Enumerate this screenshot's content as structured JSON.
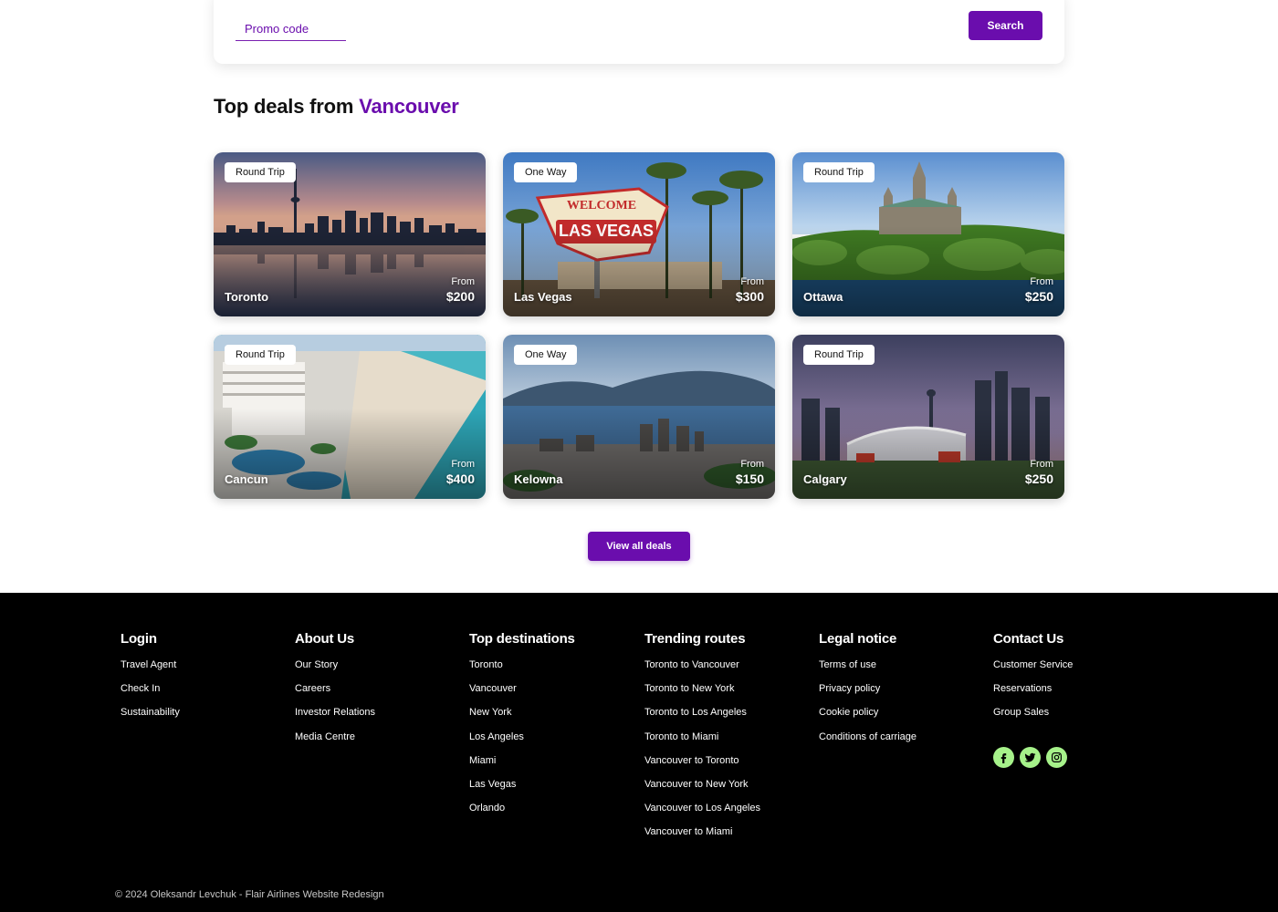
{
  "search": {
    "promo_placeholder": "Promo code",
    "search_label": "Search"
  },
  "deals": {
    "title_prefix": "Top deals from",
    "origin_city": "Vancouver",
    "price_prefix": "From",
    "cards": [
      {
        "trip_type": "Round Trip",
        "city": "Toronto",
        "price": "$200"
      },
      {
        "trip_type": "One Way",
        "city": "Las Vegas",
        "price": "$300"
      },
      {
        "trip_type": "Round Trip",
        "city": "Ottawa",
        "price": "$250"
      },
      {
        "trip_type": "Round Trip",
        "city": "Cancun",
        "price": "$400"
      },
      {
        "trip_type": "One Way",
        "city": "Kelowna",
        "price": "$150"
      },
      {
        "trip_type": "Round Trip",
        "city": "Calgary",
        "price": "$250"
      }
    ],
    "view_all_label": "View all deals"
  },
  "footer": {
    "columns": [
      {
        "title": "Login",
        "links": [
          "Travel Agent",
          "Check In",
          "Sustainability"
        ]
      },
      {
        "title": "About Us",
        "links": [
          "Our Story",
          "Careers",
          "Investor Relations",
          "Media Centre"
        ]
      },
      {
        "title": "Top destinations",
        "links": [
          "Toronto",
          "Vancouver",
          "New York",
          "Los Angeles",
          "Miami",
          "Las Vegas",
          "Orlando"
        ]
      },
      {
        "title": "Trending routes",
        "links": [
          "Toronto to Vancouver",
          "Toronto to New York",
          "Toronto to Los Angeles",
          "Toronto to Miami",
          "Vancouver to Toronto",
          "Vancouver to New York",
          "Vancouver to Los Angeles",
          "Vancouver to Miami"
        ]
      },
      {
        "title": "Legal notice",
        "links": [
          "Terms of use",
          "Privacy policy",
          "Cookie policy",
          "Conditions of carriage"
        ]
      },
      {
        "title": "Contact Us",
        "links": [
          "Customer Service",
          "Reservations",
          "Group Sales"
        ]
      }
    ],
    "socials": [
      "facebook-icon",
      "twitter-icon",
      "instagram-icon"
    ],
    "copyright": "© 2024 Oleksandr Levchuk - Flair Airlines Website Redesign"
  },
  "colors": {
    "brand_purple": "#6a0dad",
    "social_green": "#a6f28a",
    "footer_bg": "#000000"
  }
}
